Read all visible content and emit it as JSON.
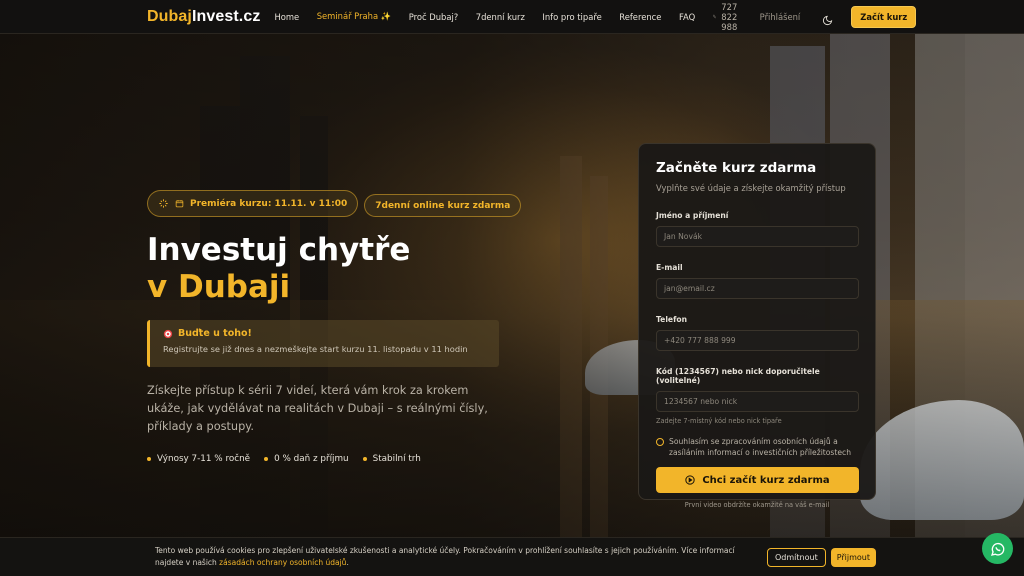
{
  "nav": {
    "logo_part1": "Dubaj",
    "logo_part2": "Invest.cz",
    "items": [
      "Home",
      "Seminář Praha ✨",
      "Proč Dubaj?",
      "7denní kurz",
      "Info pro tipaře",
      "Reference",
      "FAQ"
    ],
    "phone": "727 822 988",
    "login": "Přihlášení",
    "cta": "Začít kurz"
  },
  "hero": {
    "badge1": "Premiéra kurzu: 11.11. v 11:00",
    "badge2": "7denní online kurz zdarma",
    "title_line1": "Investuj chytře",
    "title_line2": "v Dubaji",
    "notice_title": "Buďte u toho!",
    "notice_text": "Registrujte se již dnes a nezmeškejte start kurzu 11. listopadu v 11 hodin",
    "description": "Získejte přístup k sérii 7 videí, která vám krok za krokem ukáže, jak vydělávat na realitách v Dubaji – s reálnými čísly, příklady a postupy.",
    "bullets": [
      "Výnosy 7-11 % ročně",
      "0 % daň z příjmu",
      "Stabilní trh"
    ]
  },
  "form": {
    "title": "Začněte kurz zdarma",
    "subtitle": "Vyplňte své údaje a získejte okamžitý přístup",
    "name_label": "Jméno a příjmení",
    "name_placeholder": "Jan Novák",
    "email_label": "E-mail",
    "email_placeholder": "jan@email.cz",
    "phone_label": "Telefon",
    "phone_placeholder": "+420 777 888 999",
    "code_label": "Kód (1234567) nebo nick doporučitele (volitelné)",
    "code_placeholder": "1234567 nebo nick",
    "code_hint": "Zadejte 7-místný kód nebo nick tipaře",
    "consent": "Souhlasím se zpracováním osobních údajů a zasíláním informací o investičních příležitostech",
    "submit": "Chci začít kurz zdarma",
    "after_note": "První video obdržíte okamžitě na váš e-mail"
  },
  "cookie": {
    "text": "Tento web používá cookies pro zlepšení uživatelské zkušenosti a analytické účely. Pokračováním v prohlížení souhlasíte s jejich používáním. Více informací najdete v našich ",
    "link": "zásadách ochrany osobních údajů",
    "end": ".",
    "deny": "Odmítnout",
    "accept": "Přijmout"
  },
  "colors": {
    "accent": "#f2b52a",
    "whatsapp": "#25b864"
  },
  "icons": [
    "calendar-icon",
    "sparkle-icon",
    "target-icon",
    "moon-icon",
    "phone-icon",
    "play-icon",
    "whatsapp-icon"
  ]
}
